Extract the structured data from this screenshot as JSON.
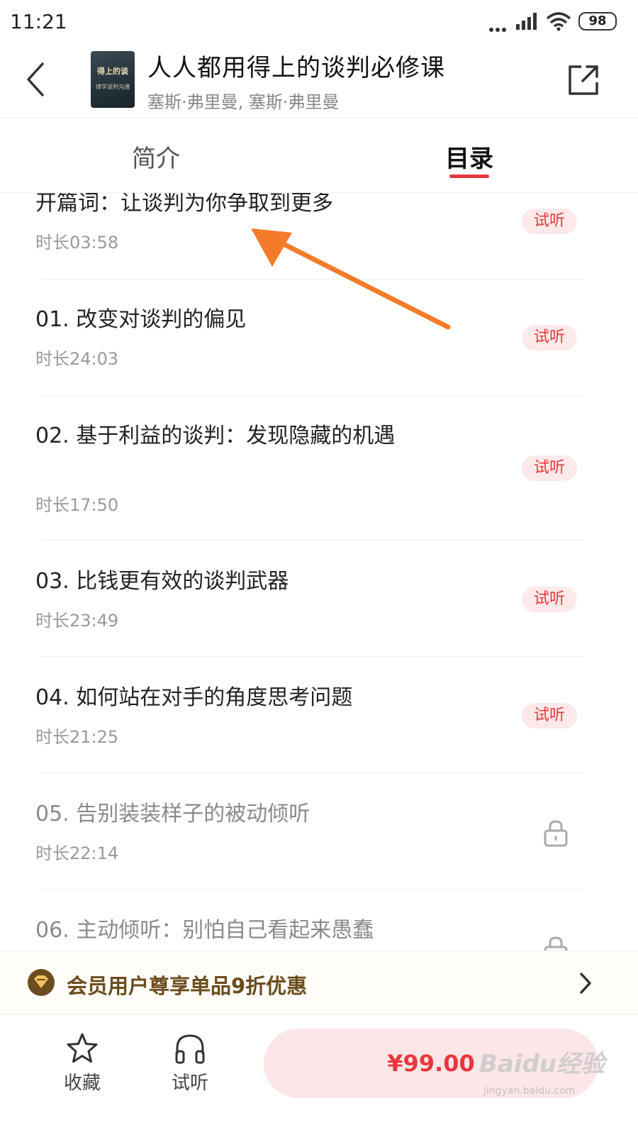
{
  "status_bar": {
    "time": "11:21",
    "battery": "98"
  },
  "header": {
    "title": "人人都用得上的谈判必修课",
    "authors": "塞斯·弗里曼, 塞斯·弗里曼",
    "cover_text_line1": "得上的谈",
    "cover_text_line2": "律学谈判沟通",
    "back_icon": "chevron-left-icon",
    "share_icon": "share-icon"
  },
  "tabs": [
    {
      "label": "简介",
      "active": false
    },
    {
      "label": "目录",
      "active": true
    }
  ],
  "accent_color": "#e8383d",
  "chapters": [
    {
      "title": "开篇词：让谈判为你争取到更多",
      "duration": "时长03:58",
      "badge": "试听",
      "locked": false
    },
    {
      "title": "01. 改变对谈判的偏见",
      "duration": "时长24:03",
      "badge": "试听",
      "locked": false
    },
    {
      "title": "02. 基于利益的谈判：发现隐藏的机遇",
      "duration": "时长17:50",
      "badge": "试听",
      "locked": false
    },
    {
      "title": "03. 比钱更有效的谈判武器",
      "duration": "时长23:49",
      "badge": "试听",
      "locked": false
    },
    {
      "title": "04. 如何站在对手的角度思考问题",
      "duration": "时长21:25",
      "badge": "试听",
      "locked": false
    },
    {
      "title": "05. 告别装装样子的被动倾听",
      "duration": "时长22:14",
      "badge": "",
      "locked": true
    },
    {
      "title": "06. 主动倾听：别怕自己看起来愚蠢",
      "duration": "",
      "badge": "",
      "locked": true
    }
  ],
  "member_banner": {
    "text": "会员用户尊享单品9折优惠"
  },
  "bottom_bar": {
    "favorite_label": "收藏",
    "listen_label": "试听",
    "price": "¥99.00"
  },
  "watermark": {
    "text": "Baidu经验",
    "sub": "jingyan.baidu.com"
  }
}
